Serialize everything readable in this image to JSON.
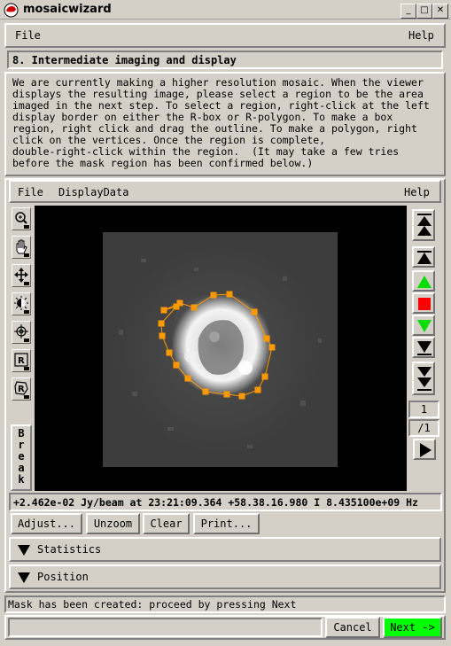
{
  "window": {
    "title": "mosaicwizard",
    "minimize_glyph": "_",
    "maximize_glyph": "□",
    "close_glyph": "✕"
  },
  "top_menu": {
    "file": "File",
    "help": "Help"
  },
  "step_title": "8. Intermediate imaging and display",
  "instructions": [
    "We are currently making a higher resolution mosaic. When the viewer",
    "displays the resulting image, please select a region to be the area",
    "imaged in the next step. To select a region, right-click at the left",
    "display border on either the R-box or R-polygon. To make a box",
    "region, right click and drag the outline. To make a polygon, right",
    "click on the vertices. Once the region is complete,",
    "double-right-click within the region.  (It may take a few tries",
    "before the mask region has been confirmed below.)"
  ],
  "viewer_menu": {
    "file": "File",
    "display_data": "DisplayData",
    "help": "Help"
  },
  "tools": [
    "zoom-icon",
    "pan-hand-icon",
    "move-arrows-icon",
    "contrast-icon",
    "crosshair-icon",
    "rectangle-region-icon",
    "polygon-region-icon"
  ],
  "break_label": "Break",
  "frame": {
    "current": "1",
    "total": "/1"
  },
  "status_readout": "+2.462e-02 Jy/beam at 23:21:09.364 +58.38.16.980 I 8.435100e+09 Hz",
  "viewer_buttons": {
    "adjust": "Adjust...",
    "unzoom": "Unzoom",
    "clear": "Clear",
    "print": "Print..."
  },
  "sections": {
    "statistics": "Statistics",
    "position": "Position"
  },
  "message": "Mask has been created: proceed by pressing Next",
  "bottom": {
    "input_value": "",
    "cancel": "Cancel",
    "next": "Next ->"
  },
  "colors": {
    "accent_next": "#00ff00",
    "polygon": "#ff9900",
    "stop": "#ff0000",
    "play_green": "#00dd00"
  }
}
